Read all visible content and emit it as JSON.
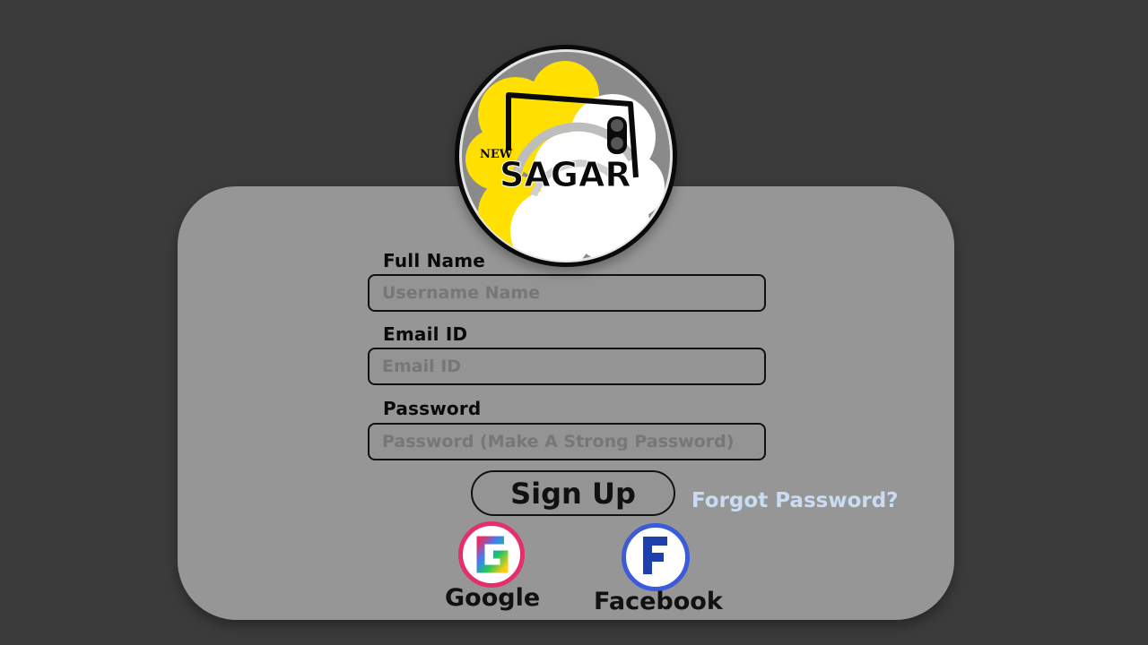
{
  "logo": {
    "small_text": "NEW",
    "main_text": "SAGAR",
    "colors": {
      "yellow": "#ffe000",
      "ring": "#0a0a0a",
      "disc": "#8a8a8a",
      "cloud": "#ffffff"
    }
  },
  "form": {
    "full_name": {
      "label": "Full Name",
      "placeholder": "Username Name"
    },
    "email": {
      "label": "Email ID",
      "placeholder": "Email ID"
    },
    "password": {
      "label": "Password",
      "placeholder": "Password (Make A Strong Password)"
    }
  },
  "actions": {
    "signup_label": "Sign Up",
    "forgot_label": "Forgot Password?"
  },
  "social": {
    "google": {
      "icon_letter": "G",
      "label": "Google",
      "ring_color": "#e3306c"
    },
    "facebook": {
      "icon_letter": "F",
      "label": "Facebook",
      "ring_color": "#3b5bdb"
    }
  },
  "colors": {
    "background": "#3b3b3b",
    "card": "#969696",
    "link": "#c9dcf3"
  }
}
